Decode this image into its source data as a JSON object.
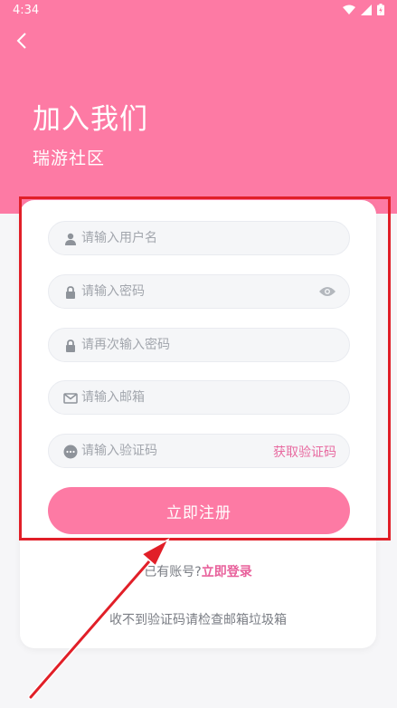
{
  "status_bar": {
    "time": "4:34"
  },
  "header": {
    "title": "加入我们",
    "subtitle": "瑞游社区"
  },
  "form": {
    "username_placeholder": "请输入用户名",
    "password_placeholder": "请输入密码",
    "confirm_placeholder": "请再次输入密码",
    "email_placeholder": "请输入邮箱",
    "code_placeholder": "请输入验证码",
    "get_code_label": "获取验证码",
    "submit_label": "立即注册"
  },
  "footer": {
    "login_prompt": "已有账号?",
    "login_link": "立即登录",
    "hint": "收不到验证码请检查邮箱垃圾箱"
  },
  "colors": {
    "brand": "#fd7aa4",
    "link": "#e8609b",
    "highlight": "#e11f28"
  }
}
